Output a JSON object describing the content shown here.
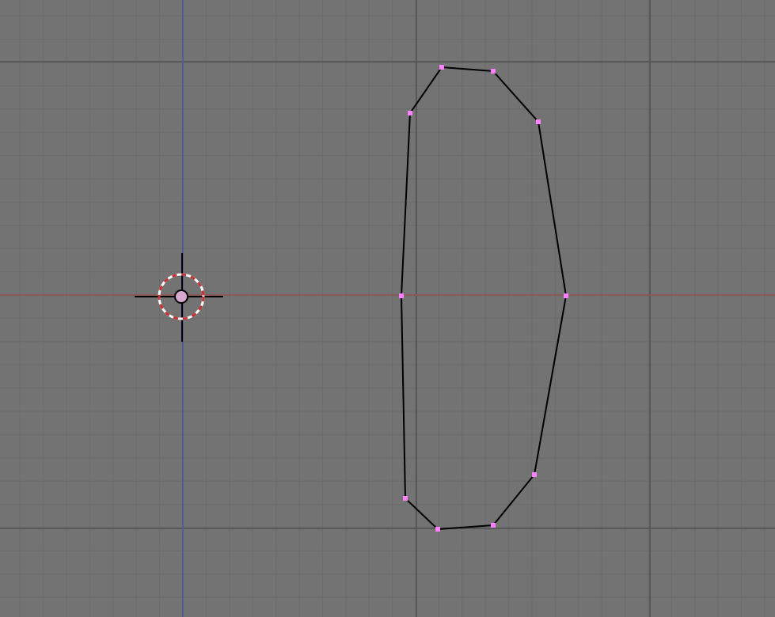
{
  "view": {
    "background_color": "#737373",
    "minor_grid_color": "#6b6b6b",
    "major_grid_color": "#585858",
    "x_axis_color": "#8a5a5a",
    "y_axis_color": "#5a5a9a",
    "edge_color": "#000000",
    "vertex_color": "#ff80ff"
  },
  "object_origin": {
    "icon": "crosshair-3d-cursor-icon",
    "ring_colors": [
      "#ffffff",
      "#c83232"
    ]
  },
  "mesh": {
    "vertex_count": 10,
    "edge_count": 10,
    "closed_loop": true
  }
}
